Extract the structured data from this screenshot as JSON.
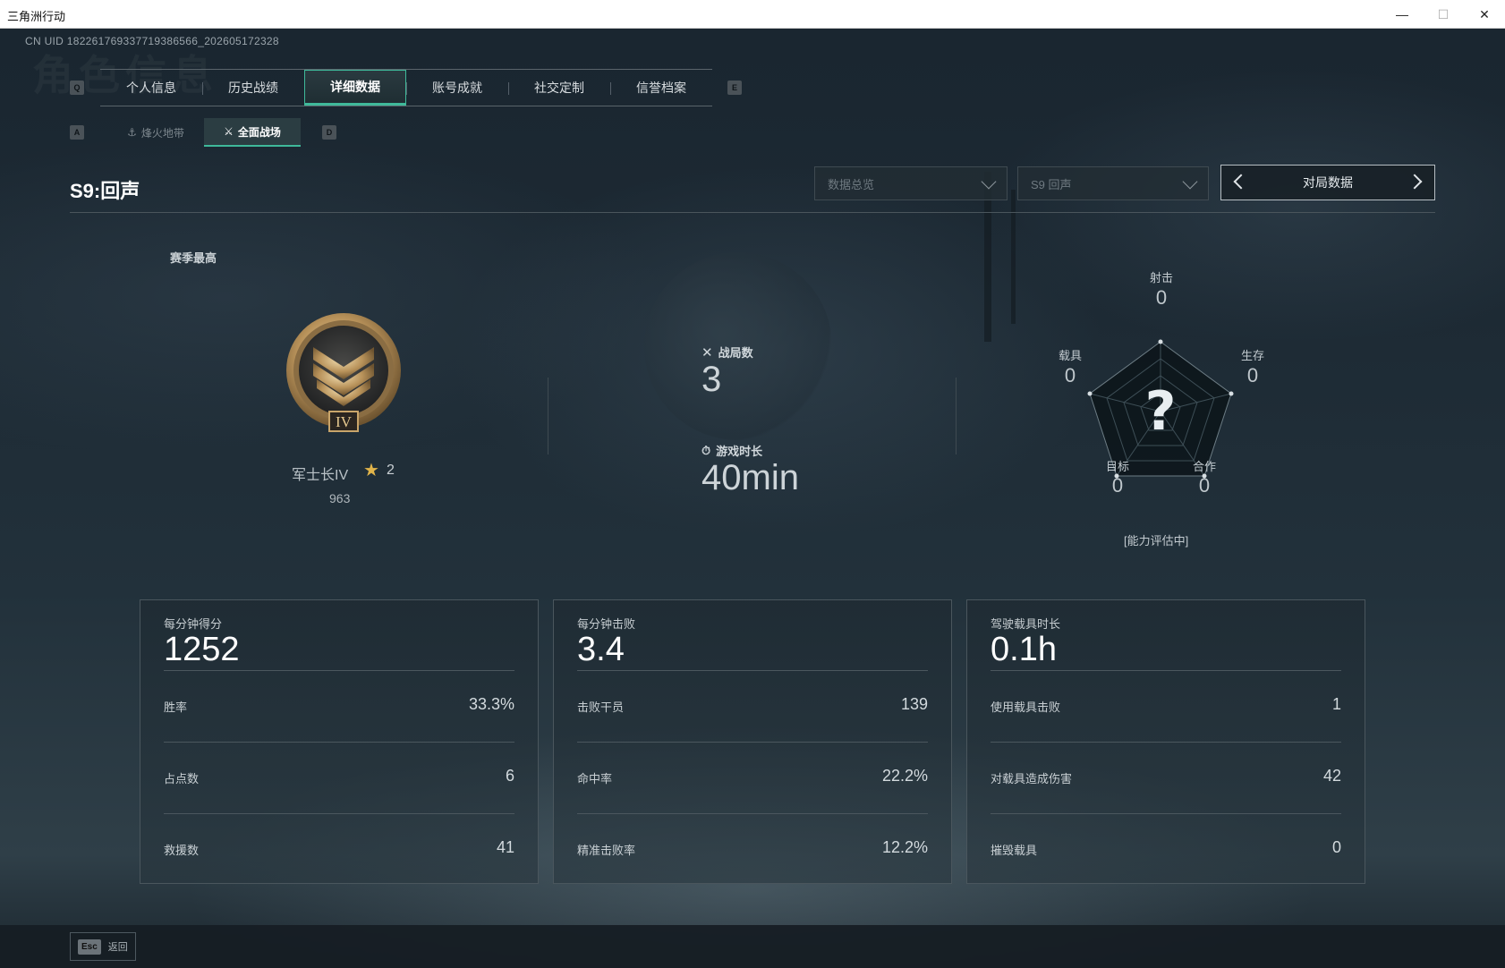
{
  "window": {
    "title": "三角洲行动",
    "minimize": "—",
    "maximize": "☐",
    "close": "✕"
  },
  "uid": "CN UID 182261769337719386566_202605172328",
  "ghost_title": "角色信息",
  "keys": {
    "q": "Q",
    "e": "E",
    "a": "A",
    "d": "D"
  },
  "tabs": [
    {
      "label": "个人信息"
    },
    {
      "label": "历史战绩"
    },
    {
      "label": "详细数据"
    },
    {
      "label": "账号成就"
    },
    {
      "label": "社交定制"
    },
    {
      "label": "信誉档案"
    }
  ],
  "active_tab": "详细数据",
  "subtabs": [
    {
      "label": "烽火地带",
      "icon": "anchor-icon"
    },
    {
      "label": "全面战场",
      "icon": "tactical-icon"
    }
  ],
  "season_title": "S9:回声",
  "dropdowns": {
    "category": "数据总览",
    "season": "S9 回声"
  },
  "pager": {
    "label": "对局数据"
  },
  "rank": {
    "season_best_label": "赛季最高",
    "name": "军士长IV",
    "roman": "IV",
    "stars": "2",
    "score": "963"
  },
  "center": {
    "matches_label": "战局数",
    "matches_value": "3",
    "time_label": "游戏时长",
    "time_value": "40min"
  },
  "radar": {
    "axes": [
      {
        "label": "射击",
        "value": "0"
      },
      {
        "label": "生存",
        "value": "0"
      },
      {
        "label": "合作",
        "value": "0"
      },
      {
        "label": "目标",
        "value": "0"
      },
      {
        "label": "载具",
        "value": "0"
      }
    ],
    "center_mark": "?",
    "status": "[能力评估中]"
  },
  "cards": [
    {
      "head_label": "每分钟得分",
      "head_value": "1252",
      "rows": [
        {
          "k": "胜率",
          "v": "33.3%"
        },
        {
          "k": "占点数",
          "v": "6"
        },
        {
          "k": "救援数",
          "v": "41"
        }
      ]
    },
    {
      "head_label": "每分钟击败",
      "head_value": "3.4",
      "rows": [
        {
          "k": "击败干员",
          "v": "139"
        },
        {
          "k": "命中率",
          "v": "22.2%"
        },
        {
          "k": "精准击败率",
          "v": "12.2%"
        }
      ]
    },
    {
      "head_label": "驾驶载具时长",
      "head_value": "0.1h",
      "rows": [
        {
          "k": "使用载具击败",
          "v": "1"
        },
        {
          "k": "对载具造成伤害",
          "v": "42"
        },
        {
          "k": "摧毁载具",
          "v": "0"
        }
      ]
    }
  ],
  "footer": {
    "esc_key": "Esc",
    "back_label": "返回"
  },
  "colors": {
    "accent": "#3fb99a",
    "gold": "#c9a56a",
    "star": "#e1b44a"
  }
}
